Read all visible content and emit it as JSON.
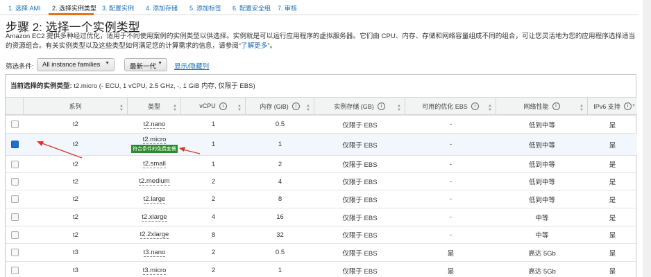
{
  "steps": [
    {
      "label": "1. 选择 AMI"
    },
    {
      "label": "2. 选择实例类型"
    },
    {
      "label": "3. 配置实例"
    },
    {
      "label": "4. 添加存储"
    },
    {
      "label": "5. 添加标签"
    },
    {
      "label": "6. 配置安全组"
    },
    {
      "label": "7. 审核"
    }
  ],
  "page": {
    "title": "步骤 2: 选择一个实例类型",
    "description": "Amazon EC2 提供多种经过优化，适用于不同使用案例的实例类型以供选择。实例就是可以运行应用程序的虚拟服务器。它们由 CPU、内存、存储和网络容量组成不同的组合，可让您灵活地为您的应用程序选择适当的资源组合。有关实例类型以及这些类型如何满足您的计算需求的信息，请参阅“",
    "learn_more": "了解更多",
    "description_end": "”。"
  },
  "filter": {
    "label": "筛选条件:",
    "family_value": "All instance families",
    "generation_value": "最新一代",
    "toggle_columns": "显示/隐藏列"
  },
  "current_selection": {
    "label": "当前选择的实例类型:",
    "value": "t2.micro (- ECU, 1 vCPU, 2.5 GHz, -, 1 GiB 内存, 仅限于 EBS)"
  },
  "table": {
    "columns": [
      "系列",
      "类型",
      "vCPU",
      "内存 (GiB)",
      "实例存储 (GB)",
      "可用的优化 EBS",
      "网络性能",
      "IPv6 支持"
    ],
    "info_icon": "i",
    "free_tier_badge": "符合条件的免费套餐",
    "rows": [
      {
        "family": "t2",
        "type": "t2.nano",
        "vcpu": "1",
        "memory": "0.5",
        "storage": "仅限于 EBS",
        "ebs_opt": "-",
        "network": "低到中等",
        "ipv6": "是",
        "selected": false
      },
      {
        "family": "t2",
        "type": "t2.micro",
        "vcpu": "1",
        "memory": "1",
        "storage": "仅限于 EBS",
        "ebs_opt": "-",
        "network": "低到中等",
        "ipv6": "是",
        "selected": true,
        "free_tier": true
      },
      {
        "family": "t2",
        "type": "t2.small",
        "vcpu": "1",
        "memory": "2",
        "storage": "仅限于 EBS",
        "ebs_opt": "-",
        "network": "低到中等",
        "ipv6": "是",
        "selected": false
      },
      {
        "family": "t2",
        "type": "t2.medium",
        "vcpu": "2",
        "memory": "4",
        "storage": "仅限于 EBS",
        "ebs_opt": "-",
        "network": "低到中等",
        "ipv6": "是",
        "selected": false
      },
      {
        "family": "t2",
        "type": "t2.large",
        "vcpu": "2",
        "memory": "8",
        "storage": "仅限于 EBS",
        "ebs_opt": "-",
        "network": "低到中等",
        "ipv6": "是",
        "selected": false
      },
      {
        "family": "t2",
        "type": "t2.xlarge",
        "vcpu": "4",
        "memory": "16",
        "storage": "仅限于 EBS",
        "ebs_opt": "-",
        "network": "中等",
        "ipv6": "是",
        "selected": false
      },
      {
        "family": "t2",
        "type": "t2.2xlarge",
        "vcpu": "8",
        "memory": "32",
        "storage": "仅限于 EBS",
        "ebs_opt": "-",
        "network": "中等",
        "ipv6": "是",
        "selected": false
      },
      {
        "family": "t3",
        "type": "t3.nano",
        "vcpu": "2",
        "memory": "0.5",
        "storage": "仅限于 EBS",
        "ebs_opt": "是",
        "network": "高达 5Gb",
        "ipv6": "是",
        "selected": false
      },
      {
        "family": "t3",
        "type": "t3.micro",
        "vcpu": "2",
        "memory": "1",
        "storage": "仅限于 EBS",
        "ebs_opt": "是",
        "network": "高达 5Gb",
        "ipv6": "是",
        "selected": false
      }
    ]
  },
  "colors": {
    "link": "#1a6fb5",
    "active_step_underline": "#ec7211",
    "annotation_arrow": "#d9342b",
    "free_tier_badge": "#2d8a2d",
    "checkbox_checked": "#1f6fd1"
  },
  "icons": {
    "caret": "caret-down-icon",
    "sort": "sort-icon",
    "info": "info-icon",
    "annotation": "red-arrow-icon"
  }
}
